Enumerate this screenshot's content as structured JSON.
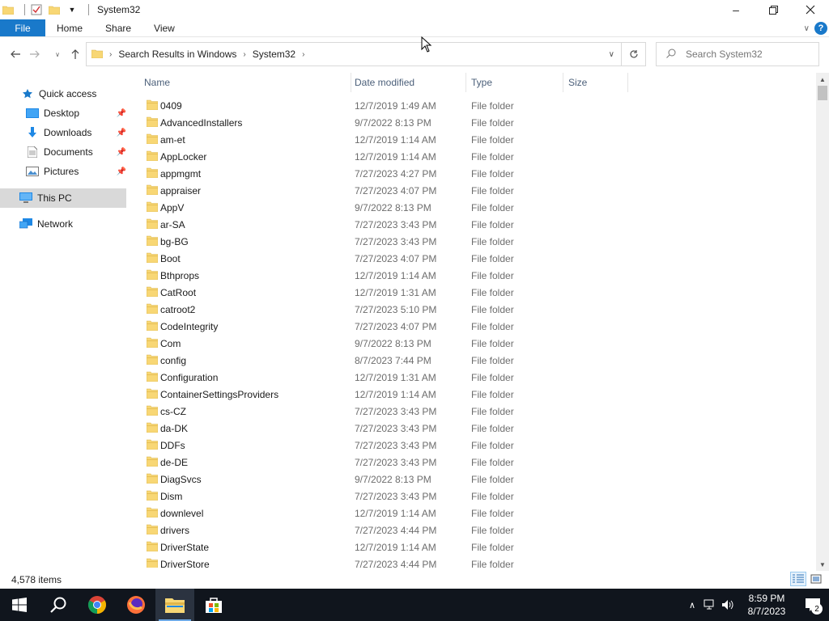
{
  "window": {
    "title": "System32"
  },
  "ribbon": {
    "file_label": "File",
    "tabs": [
      "Home",
      "Share",
      "View"
    ]
  },
  "address": {
    "crumbs": [
      "Search Results in Windows",
      "System32"
    ]
  },
  "search": {
    "placeholder": "Search System32"
  },
  "nav": {
    "quick_access": "Quick access",
    "desktop": "Desktop",
    "downloads": "Downloads",
    "documents": "Documents",
    "pictures": "Pictures",
    "this_pc": "This PC",
    "network": "Network"
  },
  "columns": {
    "name": "Name",
    "date": "Date modified",
    "type": "Type",
    "size": "Size"
  },
  "files": [
    {
      "name": "0409",
      "date": "12/7/2019 1:49 AM",
      "type": "File folder"
    },
    {
      "name": "AdvancedInstallers",
      "date": "9/7/2022 8:13 PM",
      "type": "File folder"
    },
    {
      "name": "am-et",
      "date": "12/7/2019 1:14 AM",
      "type": "File folder"
    },
    {
      "name": "AppLocker",
      "date": "12/7/2019 1:14 AM",
      "type": "File folder"
    },
    {
      "name": "appmgmt",
      "date": "7/27/2023 4:27 PM",
      "type": "File folder"
    },
    {
      "name": "appraiser",
      "date": "7/27/2023 4:07 PM",
      "type": "File folder"
    },
    {
      "name": "AppV",
      "date": "9/7/2022 8:13 PM",
      "type": "File folder"
    },
    {
      "name": "ar-SA",
      "date": "7/27/2023 3:43 PM",
      "type": "File folder"
    },
    {
      "name": "bg-BG",
      "date": "7/27/2023 3:43 PM",
      "type": "File folder"
    },
    {
      "name": "Boot",
      "date": "7/27/2023 4:07 PM",
      "type": "File folder"
    },
    {
      "name": "Bthprops",
      "date": "12/7/2019 1:14 AM",
      "type": "File folder"
    },
    {
      "name": "CatRoot",
      "date": "12/7/2019 1:31 AM",
      "type": "File folder"
    },
    {
      "name": "catroot2",
      "date": "7/27/2023 5:10 PM",
      "type": "File folder"
    },
    {
      "name": "CodeIntegrity",
      "date": "7/27/2023 4:07 PM",
      "type": "File folder"
    },
    {
      "name": "Com",
      "date": "9/7/2022 8:13 PM",
      "type": "File folder"
    },
    {
      "name": "config",
      "date": "8/7/2023 7:44 PM",
      "type": "File folder"
    },
    {
      "name": "Configuration",
      "date": "12/7/2019 1:31 AM",
      "type": "File folder"
    },
    {
      "name": "ContainerSettingsProviders",
      "date": "12/7/2019 1:14 AM",
      "type": "File folder"
    },
    {
      "name": "cs-CZ",
      "date": "7/27/2023 3:43 PM",
      "type": "File folder"
    },
    {
      "name": "da-DK",
      "date": "7/27/2023 3:43 PM",
      "type": "File folder"
    },
    {
      "name": "DDFs",
      "date": "7/27/2023 3:43 PM",
      "type": "File folder"
    },
    {
      "name": "de-DE",
      "date": "7/27/2023 3:43 PM",
      "type": "File folder"
    },
    {
      "name": "DiagSvcs",
      "date": "9/7/2022 8:13 PM",
      "type": "File folder"
    },
    {
      "name": "Dism",
      "date": "7/27/2023 3:43 PM",
      "type": "File folder"
    },
    {
      "name": "downlevel",
      "date": "12/7/2019 1:14 AM",
      "type": "File folder"
    },
    {
      "name": "drivers",
      "date": "7/27/2023 4:44 PM",
      "type": "File folder"
    },
    {
      "name": "DriverState",
      "date": "12/7/2019 1:14 AM",
      "type": "File folder"
    },
    {
      "name": "DriverStore",
      "date": "7/27/2023 4:44 PM",
      "type": "File folder"
    }
  ],
  "status": {
    "items": "4,578 items"
  },
  "taskbar": {
    "time": "8:59 PM",
    "date": "8/7/2023",
    "notifications": "2"
  },
  "colors": {
    "accent": "#1979ca",
    "folder": "#f8d775",
    "taskbar": "#10151d"
  }
}
